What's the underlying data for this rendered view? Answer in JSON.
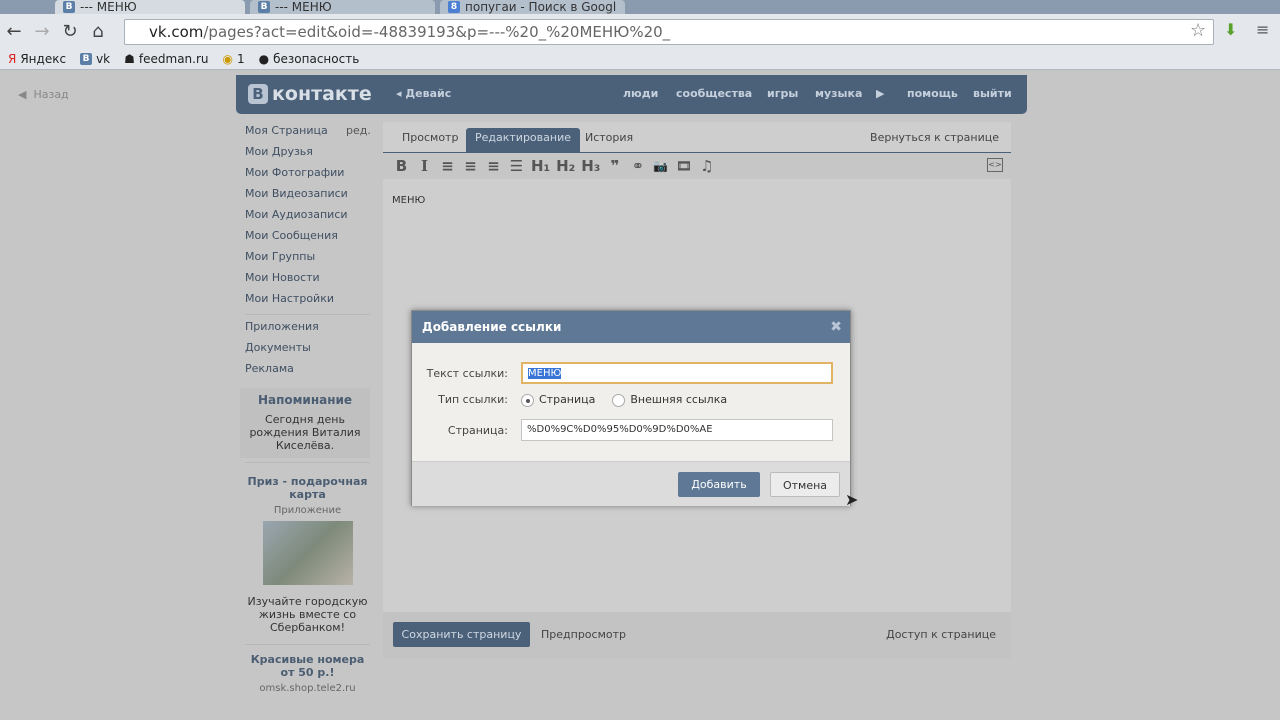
{
  "browser": {
    "tabs": [
      {
        "title": "--- МЕНЮ",
        "icon": "В"
      },
      {
        "title": "--- МЕНЮ",
        "icon": "В"
      },
      {
        "title": "попугаи - Поиск в Googl",
        "icon": "8"
      }
    ],
    "url_host": "vk.com",
    "url_path": "/pages?act=edit&oid=-48839193&p=---%20_%20МЕНЮ%20_",
    "bookmarks": [
      "Яндекс",
      "vk",
      "feedman.ru",
      "1",
      "безопасность"
    ]
  },
  "back": "Назад",
  "header": {
    "logo": "контакте",
    "logo_letter": "В",
    "group": "Девайс",
    "nav": [
      "люди",
      "сообщества",
      "игры",
      "музыка",
      "помощь",
      "выйти"
    ]
  },
  "sidebar": {
    "edit": "ред.",
    "items": [
      "Моя Страница",
      "Мои Друзья",
      "Мои Фотографии",
      "Мои Видеозаписи",
      "Мои Аудиозаписи",
      "Мои Сообщения",
      "Мои Группы",
      "Мои Новости",
      "Мои Настройки"
    ],
    "items2": [
      "Приложения",
      "Документы",
      "Реклама"
    ],
    "reminder": {
      "title": "Напоминание",
      "text": "Сегодня день рождения Виталия Киселёва."
    },
    "ad1": {
      "title": "Приз - подарочная карта",
      "sub": "Приложение",
      "text": "Изучайте городскую жизнь вместе со Сбербанком!"
    },
    "ad2": {
      "title": "Красивые номера от 50 р.!",
      "sub": "omsk.shop.tele2.ru"
    }
  },
  "main": {
    "tabs": [
      "Просмотр",
      "Редактирование",
      "История"
    ],
    "back_link": "Вернуться к странице",
    "toolbar": [
      "B",
      "I",
      "≡",
      "≡",
      "≡",
      "☰",
      "H₁",
      "H₂",
      "H₃",
      "❞",
      "⚭",
      "📷",
      "🎞",
      "♫"
    ],
    "content": "МЕНЮ",
    "save": "Сохранить страницу",
    "preview": "Предпросмотр",
    "access": "Доступ к странице"
  },
  "dialog": {
    "title": "Добавление ссылки",
    "text_label": "Текст ссылки:",
    "text_value": "МЕНЮ",
    "type_label": "Тип ссылки:",
    "type_page": "Страница",
    "type_external": "Внешняя ссылка",
    "page_label": "Страница:",
    "page_value": "%D0%9C%D0%95%D0%9D%D0%AE",
    "add": "Добавить",
    "cancel": "Отмена"
  }
}
